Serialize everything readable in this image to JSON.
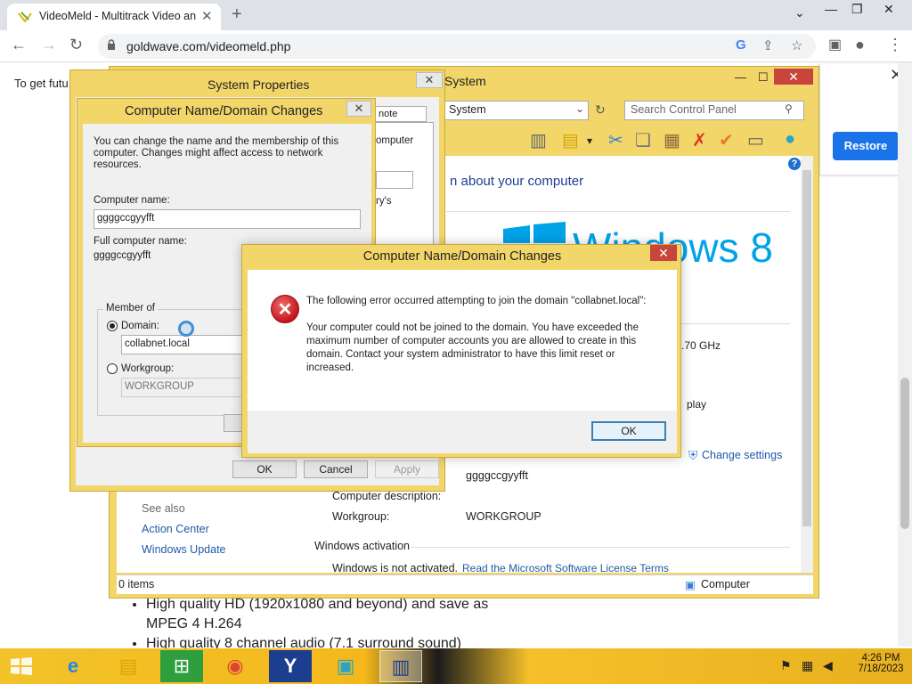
{
  "browser": {
    "tab_title": "VideoMeld - Multitrack Video an",
    "url": "goldwave.com/videomeld.php",
    "new_tab_icon": "plus-icon",
    "min_icon": "chevron-down-icon"
  },
  "webpage": {
    "banner_text": "To get futu",
    "restore_button": "Restore",
    "bullets": [
      "High quality HD (1920x1080 and beyond) and save as",
      "MPEG 4 H.264",
      "High quality 8 channel audio (7.1 surround sound)"
    ]
  },
  "control_panel": {
    "title": "System",
    "address": "System",
    "search_placeholder": "Search Control Panel",
    "heading": "n about your computer",
    "os_name": "Windows 8",
    "cpu_fragment": ".70 GHz",
    "display_fragment": "play",
    "change_settings": "Change settings",
    "computer_name_value": "ggggccgyyfft",
    "computer_description_label": "Computer description:",
    "workgroup_label": "Workgroup:",
    "workgroup_value": "WORKGROUP",
    "see_also": "See also",
    "see_also_links": [
      "Action Center",
      "Windows Update"
    ],
    "activation_heading": "Windows activation",
    "activation_status": "Windows is not activated.",
    "license_link": "Read the Microsoft Software License Terms",
    "status_items": "0 items",
    "status_computer": "Computer"
  },
  "system_properties": {
    "title": "System Properties",
    "tab_fragment": "note",
    "panel_fragments": [
      "omputer",
      "ry's"
    ],
    "ok": "OK",
    "cancel": "Cancel",
    "apply": "Apply"
  },
  "name_dialog": {
    "title": "Computer Name/Domain Changes",
    "description": "You can change the name and the membership of this computer. Changes might affect access to network resources.",
    "computer_name_label": "Computer name:",
    "computer_name_value": "ggggccgyyfft",
    "full_name_label": "Full computer name:",
    "full_name_value": "ggggccgyyfft",
    "member_of": "Member of",
    "domain_label": "Domain:",
    "domain_value": "collabnet.local",
    "workgroup_label": "Workgroup:",
    "workgroup_value": "WORKGROUP"
  },
  "error_dialog": {
    "title": "Computer Name/Domain Changes",
    "message": "The following error occurred attempting to join the domain \"collabnet.local\":\n\nYour computer could not be joined to the domain. You have exceeded the maximum number of computer accounts you are allowed to create in this domain. Contact your system administrator to have this limit reset or increased.",
    "ok": "OK"
  },
  "taskbar": {
    "time": "4:26 PM",
    "date": "7/18/2023"
  },
  "colors": {
    "window_frame": "#f2d66a",
    "close_red": "#c7453a",
    "link_blue": "#1e5aa8",
    "restore_blue": "#1a73e8"
  }
}
